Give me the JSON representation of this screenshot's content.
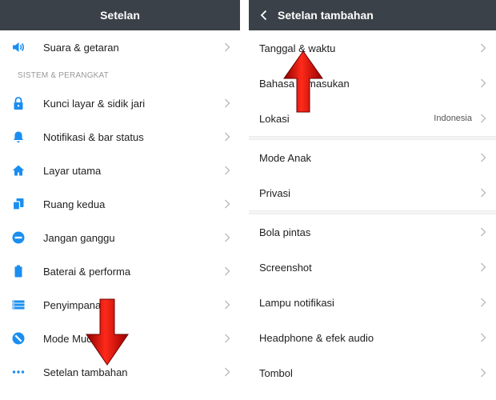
{
  "left": {
    "title": "Setelan",
    "top_item": {
      "label": "Suara & getaran",
      "icon": "speaker-icon"
    },
    "section_header": "SISTEM & PERANGKAT",
    "items": [
      {
        "label": "Kunci layar & sidik jari",
        "icon": "lock-icon"
      },
      {
        "label": "Notifikasi & bar status",
        "icon": "bell-icon"
      },
      {
        "label": "Layar utama",
        "icon": "home-icon"
      },
      {
        "label": "Ruang kedua",
        "icon": "second-space-icon"
      },
      {
        "label": "Jangan ganggu",
        "icon": "do-not-disturb-icon"
      },
      {
        "label": "Baterai & performa",
        "icon": "battery-icon"
      },
      {
        "label": "Penyimpanan",
        "icon": "storage-icon"
      },
      {
        "label": "Mode Mudah",
        "icon": "easy-mode-icon"
      },
      {
        "label": "Setelan tambahan",
        "icon": "more-icon"
      }
    ]
  },
  "right": {
    "title": "Setelan tambahan",
    "group1": [
      {
        "label": "Tanggal & waktu"
      },
      {
        "label": "Bahasa & masukan"
      },
      {
        "label": "Lokasi",
        "value": "Indonesia"
      }
    ],
    "group2": [
      {
        "label": "Mode Anak"
      },
      {
        "label": "Privasi"
      }
    ],
    "group3": [
      {
        "label": "Bola pintas"
      },
      {
        "label": "Screenshot"
      },
      {
        "label": "Lampu notifikasi"
      },
      {
        "label": "Headphone & efek audio"
      },
      {
        "label": "Tombol"
      }
    ]
  },
  "colors": {
    "accent_icon": "#1a8ef0",
    "titlebar": "#3b4148",
    "arrow": "#e01010"
  }
}
